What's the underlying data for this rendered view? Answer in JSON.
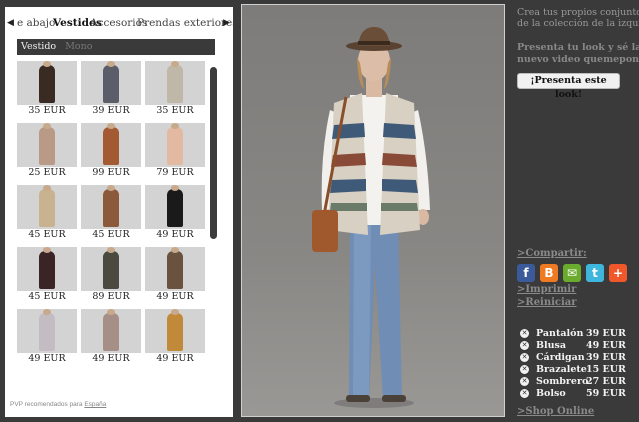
{
  "categories": {
    "prev_icon": "triangle-left-icon",
    "next_icon": "triangle-right-icon",
    "tabs": [
      {
        "label": "e abajo",
        "active": false
      },
      {
        "label": "Vestidos",
        "active": true
      },
      {
        "label": "Accesorios",
        "active": false
      },
      {
        "label": "Prendas exteriores",
        "active": false
      }
    ]
  },
  "subcategories": [
    {
      "label": "Vestido",
      "active": true
    },
    {
      "label": "Mono",
      "active": false
    }
  ],
  "products": [
    {
      "price": "35 EUR",
      "color": "#3a2a24"
    },
    {
      "price": "39 EUR",
      "color": "#5b5d68"
    },
    {
      "price": "35 EUR",
      "color": "#bfb7a8"
    },
    {
      "price": "25 EUR",
      "color": "#b89a86"
    },
    {
      "price": "99 EUR",
      "color": "#a35a33"
    },
    {
      "price": "79 EUR",
      "color": "#e4b9a2"
    },
    {
      "price": "45 EUR",
      "color": "#c8b290"
    },
    {
      "price": "45 EUR",
      "color": "#8a5a3a"
    },
    {
      "price": "49 EUR",
      "color": "#1a1a1a"
    },
    {
      "price": "45 EUR",
      "color": "#3b2426"
    },
    {
      "price": "89 EUR",
      "color": "#4a4a40"
    },
    {
      "price": "49 EUR",
      "color": "#6a5240"
    },
    {
      "price": "49 EUR",
      "color": "#c3bcc3"
    },
    {
      "price": "49 EUR",
      "color": "#a58f87"
    },
    {
      "price": "49 EUR",
      "color": "#c08a3a"
    }
  ],
  "footnote": {
    "prefix": "PVP recomendados para",
    "link": "España"
  },
  "right": {
    "intro_line1": "Crea tus propios conjuntos",
    "intro_line2": "de la colección de la izquier",
    "bold_line1": "Presenta tu look y sé la est",
    "bold_line2": "nuevo video quemepongo",
    "present_button": "¡Presenta este look!"
  },
  "share": {
    "compartir": ">Compartir:",
    "imprimir": ">Imprimir",
    "reiniciar": ">Reiniciar",
    "icons": [
      {
        "name": "facebook-icon",
        "glyph": "f",
        "color": "#3b5a9a"
      },
      {
        "name": "blogger-icon",
        "glyph": "B",
        "color": "#f07a22"
      },
      {
        "name": "email-icon",
        "glyph": "✉",
        "color": "#6aab2e"
      },
      {
        "name": "twitter-icon",
        "glyph": "t",
        "color": "#3fb6dc"
      },
      {
        "name": "addthis-icon",
        "glyph": "+",
        "color": "#f0582c"
      }
    ]
  },
  "outfit": [
    {
      "name": "Pantalón",
      "price": "39 EUR"
    },
    {
      "name": "Blusa",
      "price": "49 EUR"
    },
    {
      "name": "Cárdigan",
      "price": "39 EUR"
    },
    {
      "name": "Brazalete",
      "price": "15 EUR"
    },
    {
      "name": "Sombrero",
      "price": "27 EUR"
    },
    {
      "name": "Bolso",
      "price": "59 EUR"
    }
  ],
  "shop_online": ">Shop Online",
  "remove_icon": "remove-circle-icon"
}
